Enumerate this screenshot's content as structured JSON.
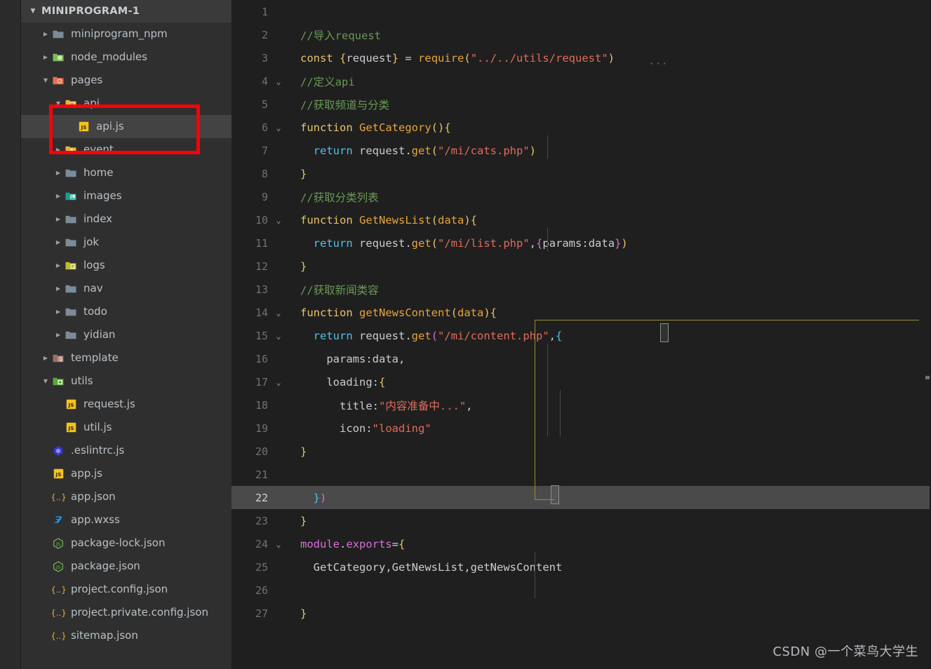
{
  "explorer": {
    "title": "MINIPROGRAM-1",
    "twisty": "▼",
    "items": [
      {
        "label": "miniprogram_npm",
        "type": "folder",
        "icon": "folder-plain-icon",
        "arrow": "▶",
        "depth": 1,
        "selected": false
      },
      {
        "label": "node_modules",
        "type": "folder",
        "icon": "folder-node-icon",
        "arrow": "▶",
        "depth": 1,
        "selected": false
      },
      {
        "label": "pages",
        "type": "folder",
        "icon": "folder-pages-icon",
        "arrow": "▼",
        "depth": 1,
        "selected": false
      },
      {
        "label": "api",
        "type": "folder",
        "icon": "folder-api-icon",
        "arrow": "▼",
        "depth": 2,
        "selected": false
      },
      {
        "label": "api.js",
        "type": "file",
        "icon": "js-file-icon",
        "arrow": "",
        "depth": 3,
        "selected": true
      },
      {
        "label": "event",
        "type": "folder",
        "icon": "folder-event-icon",
        "arrow": "▶",
        "depth": 2,
        "selected": false
      },
      {
        "label": "home",
        "type": "folder",
        "icon": "folder-plain-icon",
        "arrow": "▶",
        "depth": 2,
        "selected": false
      },
      {
        "label": "images",
        "type": "folder",
        "icon": "folder-images-icon",
        "arrow": "▶",
        "depth": 2,
        "selected": false
      },
      {
        "label": "index",
        "type": "folder",
        "icon": "folder-plain-icon",
        "arrow": "▶",
        "depth": 2,
        "selected": false
      },
      {
        "label": "jok",
        "type": "folder",
        "icon": "folder-plain-icon",
        "arrow": "▶",
        "depth": 2,
        "selected": false
      },
      {
        "label": "logs",
        "type": "folder",
        "icon": "folder-logs-icon",
        "arrow": "▶",
        "depth": 2,
        "selected": false
      },
      {
        "label": "nav",
        "type": "folder",
        "icon": "folder-plain-icon",
        "arrow": "▶",
        "depth": 2,
        "selected": false
      },
      {
        "label": "todo",
        "type": "folder",
        "icon": "folder-plain-icon",
        "arrow": "▶",
        "depth": 2,
        "selected": false
      },
      {
        "label": "yidian",
        "type": "folder",
        "icon": "folder-plain-icon",
        "arrow": "▶",
        "depth": 2,
        "selected": false
      },
      {
        "label": "template",
        "type": "folder",
        "icon": "folder-template-icon",
        "arrow": "▶",
        "depth": 1,
        "selected": false
      },
      {
        "label": "utils",
        "type": "folder",
        "icon": "folder-utils-icon",
        "arrow": "▼",
        "depth": 1,
        "selected": false
      },
      {
        "label": "request.js",
        "type": "file",
        "icon": "js-file-icon",
        "arrow": "",
        "depth": 2,
        "selected": false
      },
      {
        "label": "util.js",
        "type": "file",
        "icon": "js-file-icon",
        "arrow": "",
        "depth": 2,
        "selected": false
      },
      {
        "label": ".eslintrc.js",
        "type": "file",
        "icon": "eslint-icon",
        "arrow": "",
        "depth": 1,
        "selected": false
      },
      {
        "label": "app.js",
        "type": "file",
        "icon": "js-file-icon",
        "arrow": "",
        "depth": 1,
        "selected": false
      },
      {
        "label": "app.json",
        "type": "file",
        "icon": "json-icon",
        "arrow": "",
        "depth": 1,
        "selected": false
      },
      {
        "label": "app.wxss",
        "type": "file",
        "icon": "css-icon",
        "arrow": "",
        "depth": 1,
        "selected": false
      },
      {
        "label": "package-lock.json",
        "type": "file",
        "icon": "nodejs-icon",
        "arrow": "",
        "depth": 1,
        "selected": false
      },
      {
        "label": "package.json",
        "type": "file",
        "icon": "nodejs-icon",
        "arrow": "",
        "depth": 1,
        "selected": false
      },
      {
        "label": "project.config.json",
        "type": "file",
        "icon": "json-icon",
        "arrow": "",
        "depth": 1,
        "selected": false
      },
      {
        "label": "project.private.config.json",
        "type": "file",
        "icon": "json-icon",
        "arrow": "",
        "depth": 1,
        "selected": false
      },
      {
        "label": "sitemap.json",
        "type": "file",
        "icon": "json-icon",
        "arrow": "",
        "depth": 1,
        "selected": false
      }
    ]
  },
  "annotation": {
    "name": "red-highlight-box",
    "color": "#fb0007"
  },
  "editor": {
    "language": "javascript",
    "active_line": 22,
    "lines": [
      {
        "n": 1,
        "fold": "",
        "tokens": []
      },
      {
        "n": 2,
        "fold": "",
        "tokens": [
          {
            "t": "//导入request",
            "c": "t-comment"
          }
        ]
      },
      {
        "n": 3,
        "fold": "",
        "tokens": [
          {
            "t": "const",
            "c": "t-key"
          },
          {
            "t": " ",
            "c": "t-op"
          },
          {
            "t": "{",
            "c": "t-paren-y"
          },
          {
            "t": "request",
            "c": "t-var"
          },
          {
            "t": "}",
            "c": "t-paren-y"
          },
          {
            "t": " = ",
            "c": "t-op"
          },
          {
            "t": "require",
            "c": "t-fn"
          },
          {
            "t": "(",
            "c": "t-paren-y"
          },
          {
            "t": "\"../../utils/request\"",
            "c": "t-str"
          },
          {
            "t": ")",
            "c": "t-paren-y"
          }
        ]
      },
      {
        "n": 4,
        "fold": "⌄",
        "tokens": [
          {
            "t": "//定义api",
            "c": "t-comment"
          }
        ]
      },
      {
        "n": 5,
        "fold": "",
        "tokens": [
          {
            "t": "//获取频道与分类",
            "c": "t-comment"
          }
        ]
      },
      {
        "n": 6,
        "fold": "⌄",
        "tokens": [
          {
            "t": "function",
            "c": "t-key"
          },
          {
            "t": " ",
            "c": "t-op"
          },
          {
            "t": "GetCategory",
            "c": "t-fn"
          },
          {
            "t": "()",
            "c": "t-paren-y"
          },
          {
            "t": "{",
            "c": "t-brace-y"
          }
        ]
      },
      {
        "n": 7,
        "fold": "",
        "tokens": [
          {
            "t": "  ",
            "c": "t-op"
          },
          {
            "t": "return",
            "c": "t-kw-blue"
          },
          {
            "t": " request",
            "c": "t-var"
          },
          {
            "t": ".",
            "c": "t-punct"
          },
          {
            "t": "get",
            "c": "t-fn"
          },
          {
            "t": "(",
            "c": "t-paren-y"
          },
          {
            "t": "\"/mi/cats.php\"",
            "c": "t-str"
          },
          {
            "t": ")",
            "c": "t-paren-y"
          }
        ]
      },
      {
        "n": 8,
        "fold": "",
        "tokens": [
          {
            "t": "}",
            "c": "t-brace-y"
          }
        ]
      },
      {
        "n": 9,
        "fold": "",
        "tokens": [
          {
            "t": "//获取分类列表",
            "c": "t-comment"
          }
        ]
      },
      {
        "n": 10,
        "fold": "⌄",
        "tokens": [
          {
            "t": "function",
            "c": "t-key"
          },
          {
            "t": " ",
            "c": "t-op"
          },
          {
            "t": "GetNewsList",
            "c": "t-fn"
          },
          {
            "t": "(",
            "c": "t-paren-y"
          },
          {
            "t": "data",
            "c": "t-fn"
          },
          {
            "t": ")",
            "c": "t-paren-y"
          },
          {
            "t": "{",
            "c": "t-brace-y"
          }
        ]
      },
      {
        "n": 11,
        "fold": "",
        "tokens": [
          {
            "t": "  ",
            "c": "t-op"
          },
          {
            "t": "return",
            "c": "t-kw-blue"
          },
          {
            "t": " request",
            "c": "t-var"
          },
          {
            "t": ".",
            "c": "t-punct"
          },
          {
            "t": "get",
            "c": "t-fn"
          },
          {
            "t": "(",
            "c": "t-paren-y"
          },
          {
            "t": "\"/mi/list.php\"",
            "c": "t-str"
          },
          {
            "t": ",",
            "c": "t-punct"
          },
          {
            "t": "{",
            "c": "t-paren-p"
          },
          {
            "t": "params",
            "c": "t-var"
          },
          {
            "t": ":",
            "c": "t-punct"
          },
          {
            "t": "data",
            "c": "t-var"
          },
          {
            "t": "}",
            "c": "t-paren-p"
          },
          {
            "t": ")",
            "c": "t-paren-y"
          }
        ]
      },
      {
        "n": 12,
        "fold": "",
        "tokens": [
          {
            "t": "}",
            "c": "t-brace-y"
          }
        ]
      },
      {
        "n": 13,
        "fold": "",
        "tokens": [
          {
            "t": "//获取新闻类容",
            "c": "t-comment"
          }
        ]
      },
      {
        "n": 14,
        "fold": "⌄",
        "tokens": [
          {
            "t": "function",
            "c": "t-key"
          },
          {
            "t": " ",
            "c": "t-op"
          },
          {
            "t": "getNewsContent",
            "c": "t-fn"
          },
          {
            "t": "(",
            "c": "t-paren-y"
          },
          {
            "t": "data",
            "c": "t-fn"
          },
          {
            "t": ")",
            "c": "t-paren-y"
          },
          {
            "t": "{",
            "c": "t-brace-y"
          }
        ]
      },
      {
        "n": 15,
        "fold": "⌄",
        "tokens": [
          {
            "t": "  ",
            "c": "t-op"
          },
          {
            "t": "return",
            "c": "t-kw-blue"
          },
          {
            "t": " request",
            "c": "t-var"
          },
          {
            "t": ".",
            "c": "t-punct"
          },
          {
            "t": "get",
            "c": "t-fn"
          },
          {
            "t": "(",
            "c": "t-paren-p"
          },
          {
            "t": "\"/mi/content.php\"",
            "c": "t-str"
          },
          {
            "t": ",",
            "c": "t-punct"
          },
          {
            "t": "{",
            "c": "t-paren-b"
          }
        ]
      },
      {
        "n": 16,
        "fold": "",
        "tokens": [
          {
            "t": "    params",
            "c": "t-var"
          },
          {
            "t": ":",
            "c": "t-punct"
          },
          {
            "t": "data",
            "c": "t-var"
          },
          {
            "t": ",",
            "c": "t-punct"
          }
        ]
      },
      {
        "n": 17,
        "fold": "⌄",
        "tokens": [
          {
            "t": "    loading",
            "c": "t-var"
          },
          {
            "t": ":",
            "c": "t-punct"
          },
          {
            "t": "{",
            "c": "t-brace-y"
          }
        ]
      },
      {
        "n": 18,
        "fold": "",
        "tokens": [
          {
            "t": "      title",
            "c": "t-var"
          },
          {
            "t": ":",
            "c": "t-punct"
          },
          {
            "t": "\"内容准备中...\"",
            "c": "t-str"
          },
          {
            "t": ",",
            "c": "t-punct"
          }
        ]
      },
      {
        "n": 19,
        "fold": "",
        "tokens": [
          {
            "t": "      icon",
            "c": "t-var"
          },
          {
            "t": ":",
            "c": "t-punct"
          },
          {
            "t": "\"loading\"",
            "c": "t-str"
          }
        ]
      },
      {
        "n": 20,
        "fold": "",
        "tokens": [
          {
            "t": "}",
            "c": "t-brace-y"
          }
        ]
      },
      {
        "n": 21,
        "fold": "",
        "tokens": []
      },
      {
        "n": 22,
        "fold": "",
        "tokens": [
          {
            "t": "  ",
            "c": "t-op"
          },
          {
            "t": "}",
            "c": "t-paren-b"
          },
          {
            "t": ")",
            "c": "t-paren-p"
          }
        ]
      },
      {
        "n": 23,
        "fold": "",
        "tokens": [
          {
            "t": "}",
            "c": "t-brace-y"
          }
        ]
      },
      {
        "n": 24,
        "fold": "⌄",
        "tokens": [
          {
            "t": "module",
            "c": "t-module"
          },
          {
            "t": ".",
            "c": "t-punct"
          },
          {
            "t": "exports",
            "c": "t-module"
          },
          {
            "t": "=",
            "c": "t-op"
          },
          {
            "t": "{",
            "c": "t-brace-y"
          }
        ]
      },
      {
        "n": 25,
        "fold": "",
        "tokens": [
          {
            "t": "  GetCategory",
            "c": "t-var"
          },
          {
            "t": ",",
            "c": "t-punct"
          },
          {
            "t": "GetNewsList",
            "c": "t-var"
          },
          {
            "t": ",",
            "c": "t-punct"
          },
          {
            "t": "getNewsContent",
            "c": "t-var"
          }
        ]
      },
      {
        "n": 26,
        "fold": "",
        "tokens": []
      },
      {
        "n": 27,
        "fold": "",
        "tokens": [
          {
            "t": "}",
            "c": "t-brace-y"
          }
        ]
      }
    ],
    "inlay_hint": "···"
  },
  "watermark": {
    "text": "CSDN @一个菜鸟大学生"
  }
}
